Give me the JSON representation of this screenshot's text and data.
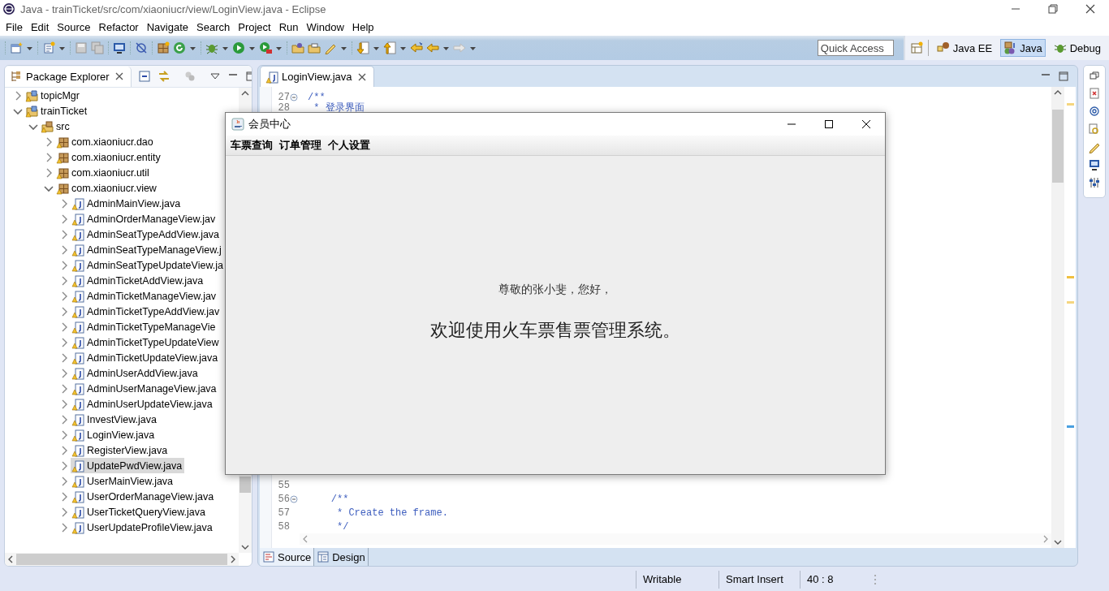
{
  "window": {
    "title": "Java - trainTicket/src/com/xiaoniucr/view/LoginView.java - Eclipse"
  },
  "menu": [
    "File",
    "Edit",
    "Source",
    "Refactor",
    "Navigate",
    "Search",
    "Project",
    "Run",
    "Window",
    "Help"
  ],
  "quick_access": {
    "placeholder": "Quick Access"
  },
  "perspectives": [
    {
      "label": "Java EE",
      "selected": false
    },
    {
      "label": "Java",
      "selected": true
    },
    {
      "label": "Debug",
      "selected": false
    }
  ],
  "package_explorer": {
    "title": "Package Explorer",
    "tree": [
      {
        "label": "topicMgr",
        "kind": "project",
        "expanded": false,
        "selected": false
      },
      {
        "label": "trainTicket",
        "kind": "project",
        "expanded": true,
        "selected": false,
        "children": [
          {
            "label": "src",
            "kind": "folder",
            "expanded": true,
            "selected": false,
            "children": [
              {
                "label": "com.xiaoniucr.dao",
                "kind": "package",
                "expanded": false,
                "selected": false
              },
              {
                "label": "com.xiaoniucr.entity",
                "kind": "package",
                "expanded": false,
                "selected": false
              },
              {
                "label": "com.xiaoniucr.util",
                "kind": "package",
                "expanded": false,
                "selected": false
              },
              {
                "label": "com.xiaoniucr.view",
                "kind": "package",
                "expanded": true,
                "selected": false,
                "children": [
                  {
                    "label": "AdminMainView.java",
                    "kind": "file",
                    "expanded": false,
                    "selected": false
                  },
                  {
                    "label": "AdminOrderManageView.jav",
                    "kind": "file",
                    "expanded": false,
                    "selected": false
                  },
                  {
                    "label": "AdminSeatTypeAddView.java",
                    "kind": "file",
                    "expanded": false,
                    "selected": false
                  },
                  {
                    "label": "AdminSeatTypeManageView.j",
                    "kind": "file",
                    "expanded": false,
                    "selected": false
                  },
                  {
                    "label": "AdminSeatTypeUpdateView.ja",
                    "kind": "file",
                    "expanded": false,
                    "selected": false
                  },
                  {
                    "label": "AdminTicketAddView.java",
                    "kind": "file",
                    "expanded": false,
                    "selected": false
                  },
                  {
                    "label": "AdminTicketManageView.jav",
                    "kind": "file",
                    "expanded": false,
                    "selected": false
                  },
                  {
                    "label": "AdminTicketTypeAddView.jav",
                    "kind": "file",
                    "expanded": false,
                    "selected": false
                  },
                  {
                    "label": "AdminTicketTypeManageVie",
                    "kind": "file",
                    "expanded": false,
                    "selected": false
                  },
                  {
                    "label": "AdminTicketTypeUpdateView",
                    "kind": "file",
                    "expanded": false,
                    "selected": false
                  },
                  {
                    "label": "AdminTicketUpdateView.java",
                    "kind": "file",
                    "expanded": false,
                    "selected": false
                  },
                  {
                    "label": "AdminUserAddView.java",
                    "kind": "file",
                    "expanded": false,
                    "selected": false
                  },
                  {
                    "label": "AdminUserManageView.java",
                    "kind": "file",
                    "expanded": false,
                    "selected": false
                  },
                  {
                    "label": "AdminUserUpdateView.java",
                    "kind": "file",
                    "expanded": false,
                    "selected": false
                  },
                  {
                    "label": "InvestView.java",
                    "kind": "file",
                    "expanded": false,
                    "selected": false
                  },
                  {
                    "label": "LoginView.java",
                    "kind": "file",
                    "expanded": false,
                    "selected": false
                  },
                  {
                    "label": "RegisterView.java",
                    "kind": "file",
                    "expanded": false,
                    "selected": false
                  },
                  {
                    "label": "UpdatePwdView.java",
                    "kind": "file",
                    "expanded": false,
                    "selected": true
                  },
                  {
                    "label": "UserMainView.java",
                    "kind": "file",
                    "expanded": false,
                    "selected": false
                  },
                  {
                    "label": "UserOrderManageView.java",
                    "kind": "file",
                    "expanded": false,
                    "selected": false
                  },
                  {
                    "label": "UserTicketQueryView.java",
                    "kind": "file",
                    "expanded": false,
                    "selected": false
                  },
                  {
                    "label": "UserUpdateProfileView.java",
                    "kind": "file",
                    "expanded": false,
                    "selected": false
                  }
                ]
              }
            ]
          }
        ]
      }
    ]
  },
  "editor": {
    "tab": "LoginView.java",
    "lines_top": [
      {
        "number": "27",
        "text": "/**",
        "foldable": true
      },
      {
        "number": "28",
        "text": " * 登录界面",
        "foldable": false
      }
    ],
    "lines_bottom": [
      {
        "number": "55",
        "foldable": false
      },
      {
        "number": "56",
        "text": "    /**",
        "foldable": true
      },
      {
        "number": "57",
        "text": "     * Create the frame.",
        "foldable": false
      },
      {
        "number": "58",
        "text": "     */",
        "foldable": false
      }
    ],
    "bottom_tabs": [
      {
        "label": "Source",
        "selected": true
      },
      {
        "label": "Design",
        "selected": false
      }
    ]
  },
  "dialog": {
    "title": "会员中心",
    "menu": [
      "车票查询",
      "订单管理",
      "个人设置"
    ],
    "greeting": "尊敬的张小斐，您好，",
    "welcome": "欢迎使用火车票售票管理系统。"
  },
  "status_bar": [
    "Writable",
    "Smart Insert",
    "40 : 8"
  ]
}
